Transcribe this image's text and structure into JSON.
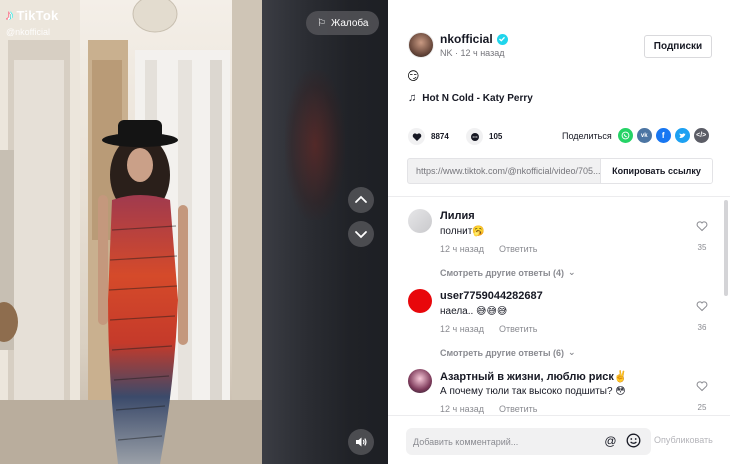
{
  "video": {
    "logo_text": "TikTok",
    "handle": "@nkofficial",
    "report_label": "Жалоба"
  },
  "post": {
    "author_name": "nkofficial",
    "author_meta": "NK · 12 ч назад",
    "follow_label": "Подписки",
    "caption": "😏",
    "music": "Hot N Cold - Katy Perry",
    "likes": "8874",
    "comments_count": "105",
    "share_label": "Поделиться",
    "link_url": "https://www.tiktok.com/@nkofficial/video/705...",
    "copy_label": "Копировать ссылку"
  },
  "share_icons": [
    "whatsapp-icon",
    "vk-icon",
    "facebook-icon",
    "twitter-icon",
    "embed-icon"
  ],
  "comments": [
    {
      "name": "Лилия",
      "text": "полнит🥱",
      "time": "12 ч назад",
      "reply": "Ответить",
      "likes": "35",
      "more": "Смотреть другие ответы (4)"
    },
    {
      "name": "user7759044282687",
      "text": "наела.. 😅😅😅",
      "time": "12 ч назад",
      "reply": "Ответить",
      "likes": "36",
      "more": "Смотреть другие ответы (6)"
    },
    {
      "name": "Азартный в жизни, люблю риск✌️",
      "text": "А почему тюли так высоко подшиты? 😳",
      "time": "12 ч назад",
      "reply": "Ответить",
      "likes": "25"
    }
  ],
  "composer": {
    "placeholder": "Добавить комментарий...",
    "publish_label": "Опубликовать"
  },
  "colors": {
    "accent": "#fe2c55",
    "verified": "#20d5ec",
    "whatsapp": "#25d366",
    "vk": "#4c75a3",
    "facebook": "#1877f2",
    "twitter": "#1da1f2",
    "embed": "#5b5d66"
  }
}
